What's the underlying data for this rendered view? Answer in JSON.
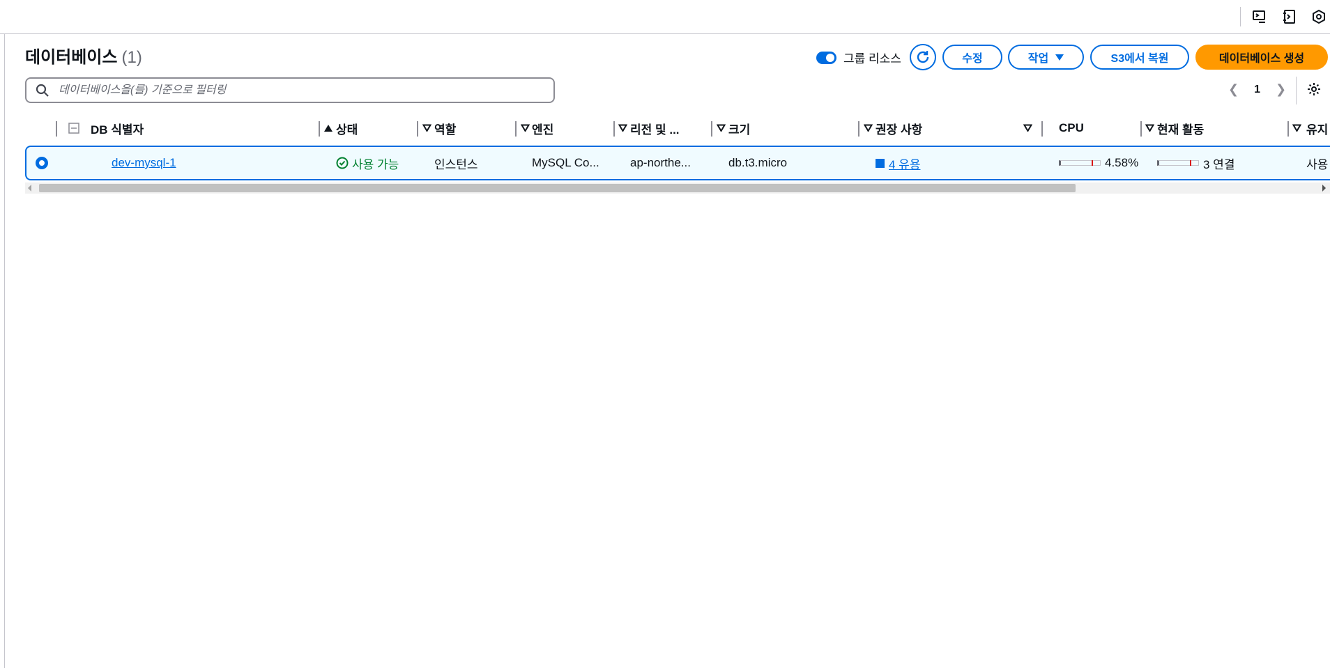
{
  "header": {
    "icons": [
      "cloudshell-icon",
      "console-log-icon",
      "settings-hex-icon"
    ]
  },
  "page": {
    "title": "데이터베이스",
    "count": "(1)"
  },
  "toolbar": {
    "group_toggle_label": "그룹 리소스",
    "group_toggle_on": true,
    "refresh_icon": "refresh-icon",
    "modify_label": "수정",
    "actions_label": "작업",
    "restore_s3_label": "S3에서 복원",
    "create_label": "데이터베이스 생성",
    "accent_color": "#006ce0",
    "primary_color": "#ff9900"
  },
  "filter": {
    "placeholder": "데이터베이스을(를) 기준으로 필터링",
    "value": ""
  },
  "pagination": {
    "current_page": "1"
  },
  "table": {
    "columns": [
      {
        "key": "id",
        "label": "DB 식별자",
        "sort": "ascending"
      },
      {
        "key": "status",
        "label": "상태"
      },
      {
        "key": "role",
        "label": "역할"
      },
      {
        "key": "engine",
        "label": "엔진"
      },
      {
        "key": "region",
        "label": "리전 및 ..."
      },
      {
        "key": "size",
        "label": "크기"
      },
      {
        "key": "recommendations",
        "label": "권장 사항"
      },
      {
        "key": "cpu",
        "label": "CPU"
      },
      {
        "key": "activity",
        "label": "현재 활동"
      },
      {
        "key": "maintenance",
        "label": "유지"
      }
    ],
    "rows": [
      {
        "selected": true,
        "id": "dev-mysql-1",
        "status": "사용 가능",
        "role": "인스턴스",
        "engine": "MySQL Co...",
        "region": "ap-northe...",
        "size": "db.t3.micro",
        "recommendations": "4 유용",
        "cpu": "4.58%",
        "activity": "3 연결",
        "maintenance": "사용"
      }
    ]
  }
}
